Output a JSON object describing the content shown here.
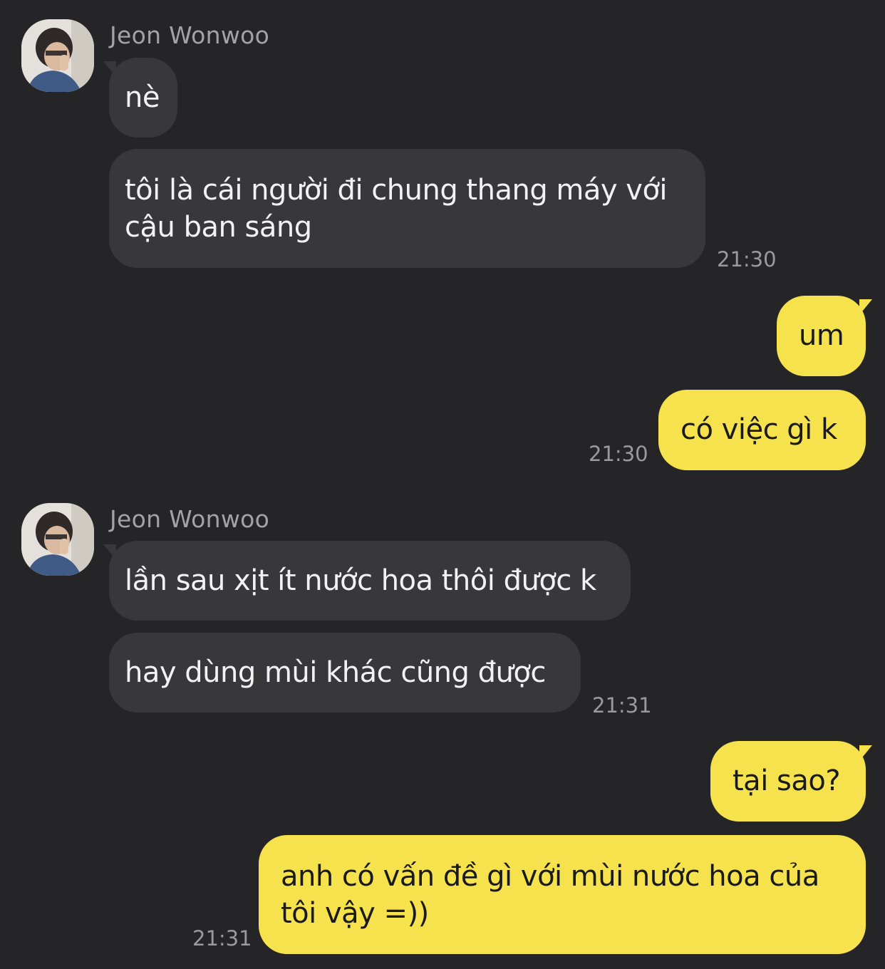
{
  "contact": {
    "name": "Jeon Wonwoo"
  },
  "messages": [
    {
      "text": "nè"
    },
    {
      "text": "tôi là cái người đi chung thang máy với cậu ban sáng"
    },
    {
      "text": "um"
    },
    {
      "text": "có việc gì k"
    },
    {
      "text": "lần sau xịt ít nước hoa thôi được k"
    },
    {
      "text": "hay dùng mùi khác cũng được"
    },
    {
      "text": "tại sao?"
    },
    {
      "text": "anh có vấn đề gì với mùi nước hoa của tôi vậy =))"
    }
  ],
  "timestamps": [
    "21:30",
    "21:30",
    "21:31",
    "21:31"
  ],
  "colors": {
    "background": "#252527",
    "incoming_bubble": "#38383b",
    "outgoing_bubble": "#f6e24c",
    "meta_text": "#a3a3a6"
  }
}
